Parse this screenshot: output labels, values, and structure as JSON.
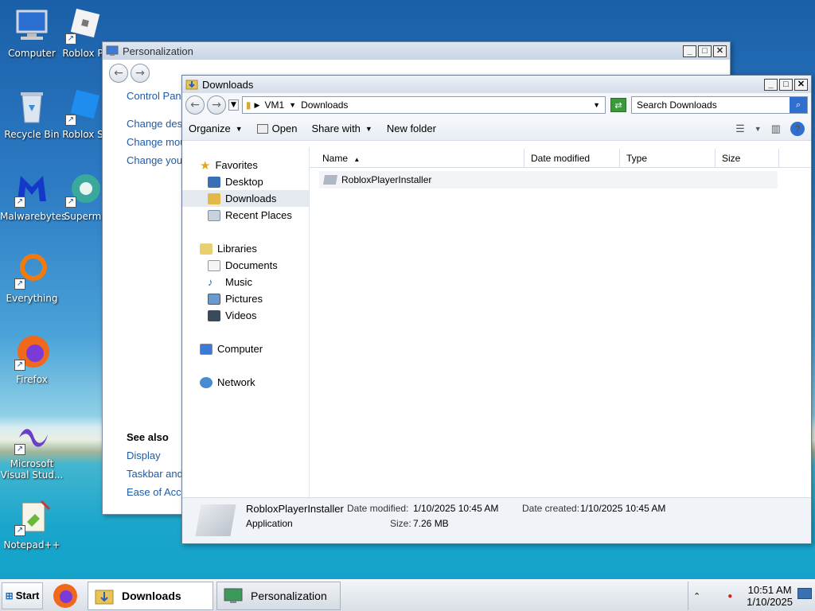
{
  "desktop": {
    "icons": [
      {
        "label": "Computer",
        "icon": "computer-icon"
      },
      {
        "label": "Roblox P",
        "icon": "roblox-icon"
      },
      {
        "label": "Recycle Bin",
        "icon": "recycle-bin-icon"
      },
      {
        "label": "Roblox S",
        "icon": "roblox-studio-icon"
      },
      {
        "label": "Malwarebytes",
        "icon": "malwarebytes-icon"
      },
      {
        "label": "Superm",
        "icon": "supermium-icon"
      },
      {
        "label": "Everything",
        "icon": "everything-icon"
      },
      {
        "label": "Firefox",
        "icon": "firefox-icon"
      },
      {
        "label": "Microsoft Visual Stud...",
        "icon": "visual-studio-icon"
      },
      {
        "label": "Notepad++",
        "icon": "notepadpp-icon"
      }
    ]
  },
  "personalization": {
    "title": "Personalization",
    "side_links": [
      "Control Pane",
      "Change desk",
      "Change mou",
      "Change your"
    ],
    "see_also": {
      "header": "See also",
      "links": [
        "Display",
        "Taskbar and",
        "Ease of Acce"
      ]
    }
  },
  "downloads": {
    "title": "Downloads",
    "address": {
      "root": "VM1",
      "folder": "Downloads"
    },
    "search_placeholder": "Search Downloads",
    "toolbar": {
      "organize": "Organize",
      "open": "Open",
      "share_with": "Share with",
      "new_folder": "New folder"
    },
    "nav": {
      "favorites": "Favorites",
      "desktop": "Desktop",
      "downloads": "Downloads",
      "recent_places": "Recent Places",
      "libraries": "Libraries",
      "documents": "Documents",
      "music": "Music",
      "pictures": "Pictures",
      "videos": "Videos",
      "computer": "Computer",
      "network": "Network"
    },
    "columns": {
      "name": "Name",
      "date_modified": "Date modified",
      "type": "Type",
      "size": "Size"
    },
    "files": [
      {
        "name": "RobloxPlayerInstaller"
      }
    ],
    "details": {
      "name": "RobloxPlayerInstaller",
      "type": "Application",
      "date_modified_label": "Date modified:",
      "date_modified": "1/10/2025 10:45 AM",
      "size_label": "Size:",
      "size": "7.26 MB",
      "date_created_label": "Date created:",
      "date_created": "1/10/2025 10:45 AM"
    }
  },
  "taskbar": {
    "start": "Start",
    "tasks": [
      {
        "label": "Downloads",
        "active": true
      },
      {
        "label": "Personalization",
        "active": false
      }
    ],
    "clock": {
      "time": "10:51 AM",
      "date": "1/10/2025"
    }
  }
}
